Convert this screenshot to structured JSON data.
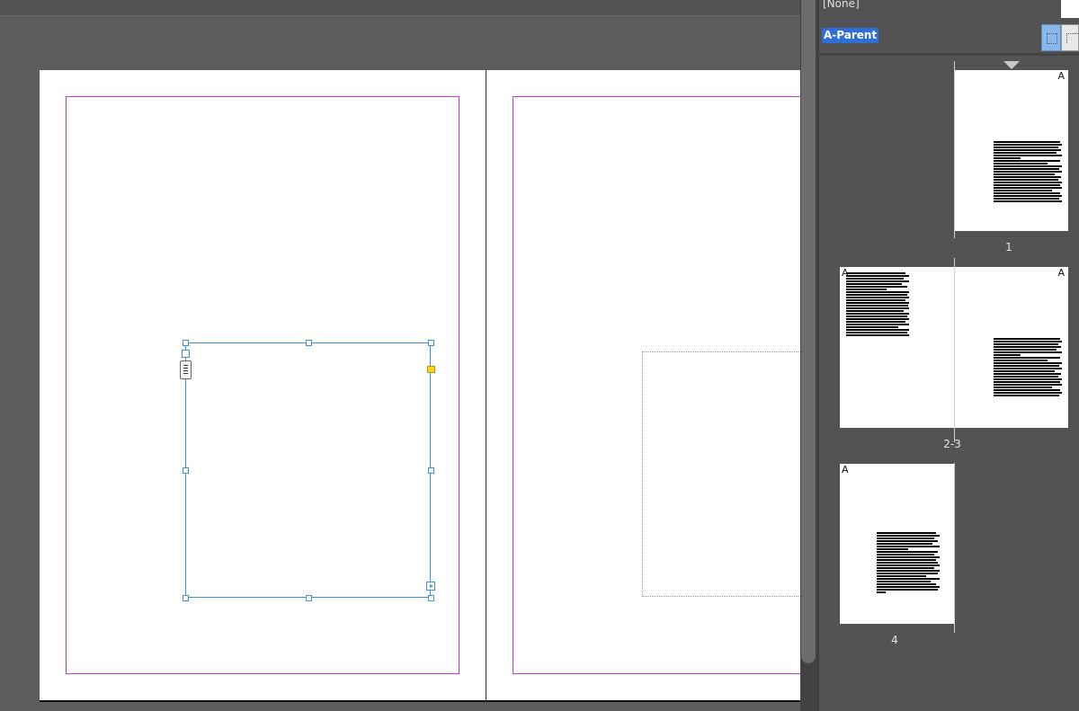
{
  "canvas": {
    "label": "document-spread"
  },
  "pages_panel": {
    "parent_none": "[None]",
    "parent_a": "A-Parent",
    "thumbnails": [
      {
        "label": "1",
        "parent_letters": [
          "A"
        ]
      },
      {
        "label": "2-3",
        "parent_letters": [
          "A",
          "A"
        ]
      },
      {
        "label": "4",
        "parent_letters": [
          "A"
        ]
      }
    ]
  },
  "colors": {
    "margin_guide": "#c43ad0",
    "frame_selection": "#3d8fd1",
    "selection_highlight": "#2d6fd6",
    "live_corner": "#ffd21f"
  }
}
